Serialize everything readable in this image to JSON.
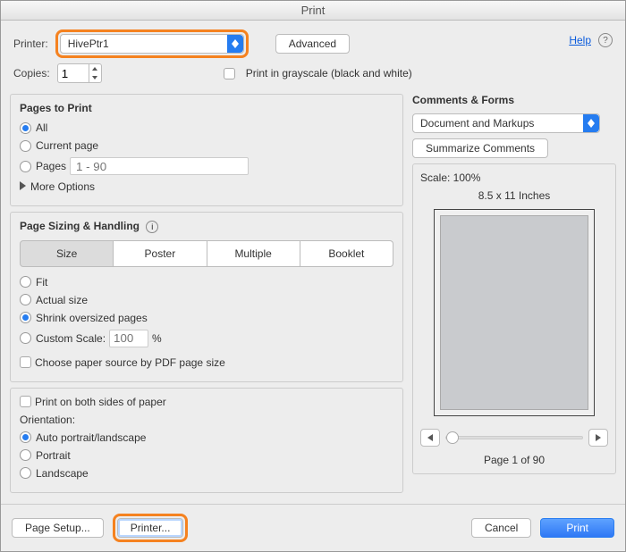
{
  "window": {
    "title": "Print"
  },
  "top": {
    "printer_label": "Printer:",
    "printer_value": "HivePtr1",
    "advanced": "Advanced",
    "copies_label": "Copies:",
    "copies_value": "1",
    "grayscale": "Print in grayscale (black and white)",
    "help": "Help"
  },
  "pages": {
    "hdr": "Pages to Print",
    "all": "All",
    "current": "Current page",
    "pages_label": "Pages",
    "pages_placeholder": "1 - 90",
    "more": "More Options"
  },
  "sizing": {
    "hdr": "Page Sizing & Handling",
    "seg": {
      "size": "Size",
      "poster": "Poster",
      "multiple": "Multiple",
      "booklet": "Booklet"
    },
    "fit": "Fit",
    "actual": "Actual size",
    "shrink": "Shrink oversized pages",
    "custom": "Custom Scale:",
    "custom_value": "100",
    "percent": "%",
    "choose_paper": "Choose paper source by PDF page size"
  },
  "duplex": {
    "both_sides": "Print on both sides of paper"
  },
  "orientation": {
    "hdr": "Orientation:",
    "auto": "Auto portrait/landscape",
    "portrait": "Portrait",
    "landscape": "Landscape"
  },
  "comments": {
    "hdr": "Comments & Forms",
    "value": "Document and Markups",
    "summarize": "Summarize Comments"
  },
  "preview": {
    "scale": "Scale: 100%",
    "dims": "8.5 x 11 Inches",
    "page_of": "Page 1 of 90"
  },
  "footer": {
    "page_setup": "Page Setup...",
    "printer": "Printer...",
    "cancel": "Cancel",
    "print": "Print"
  }
}
